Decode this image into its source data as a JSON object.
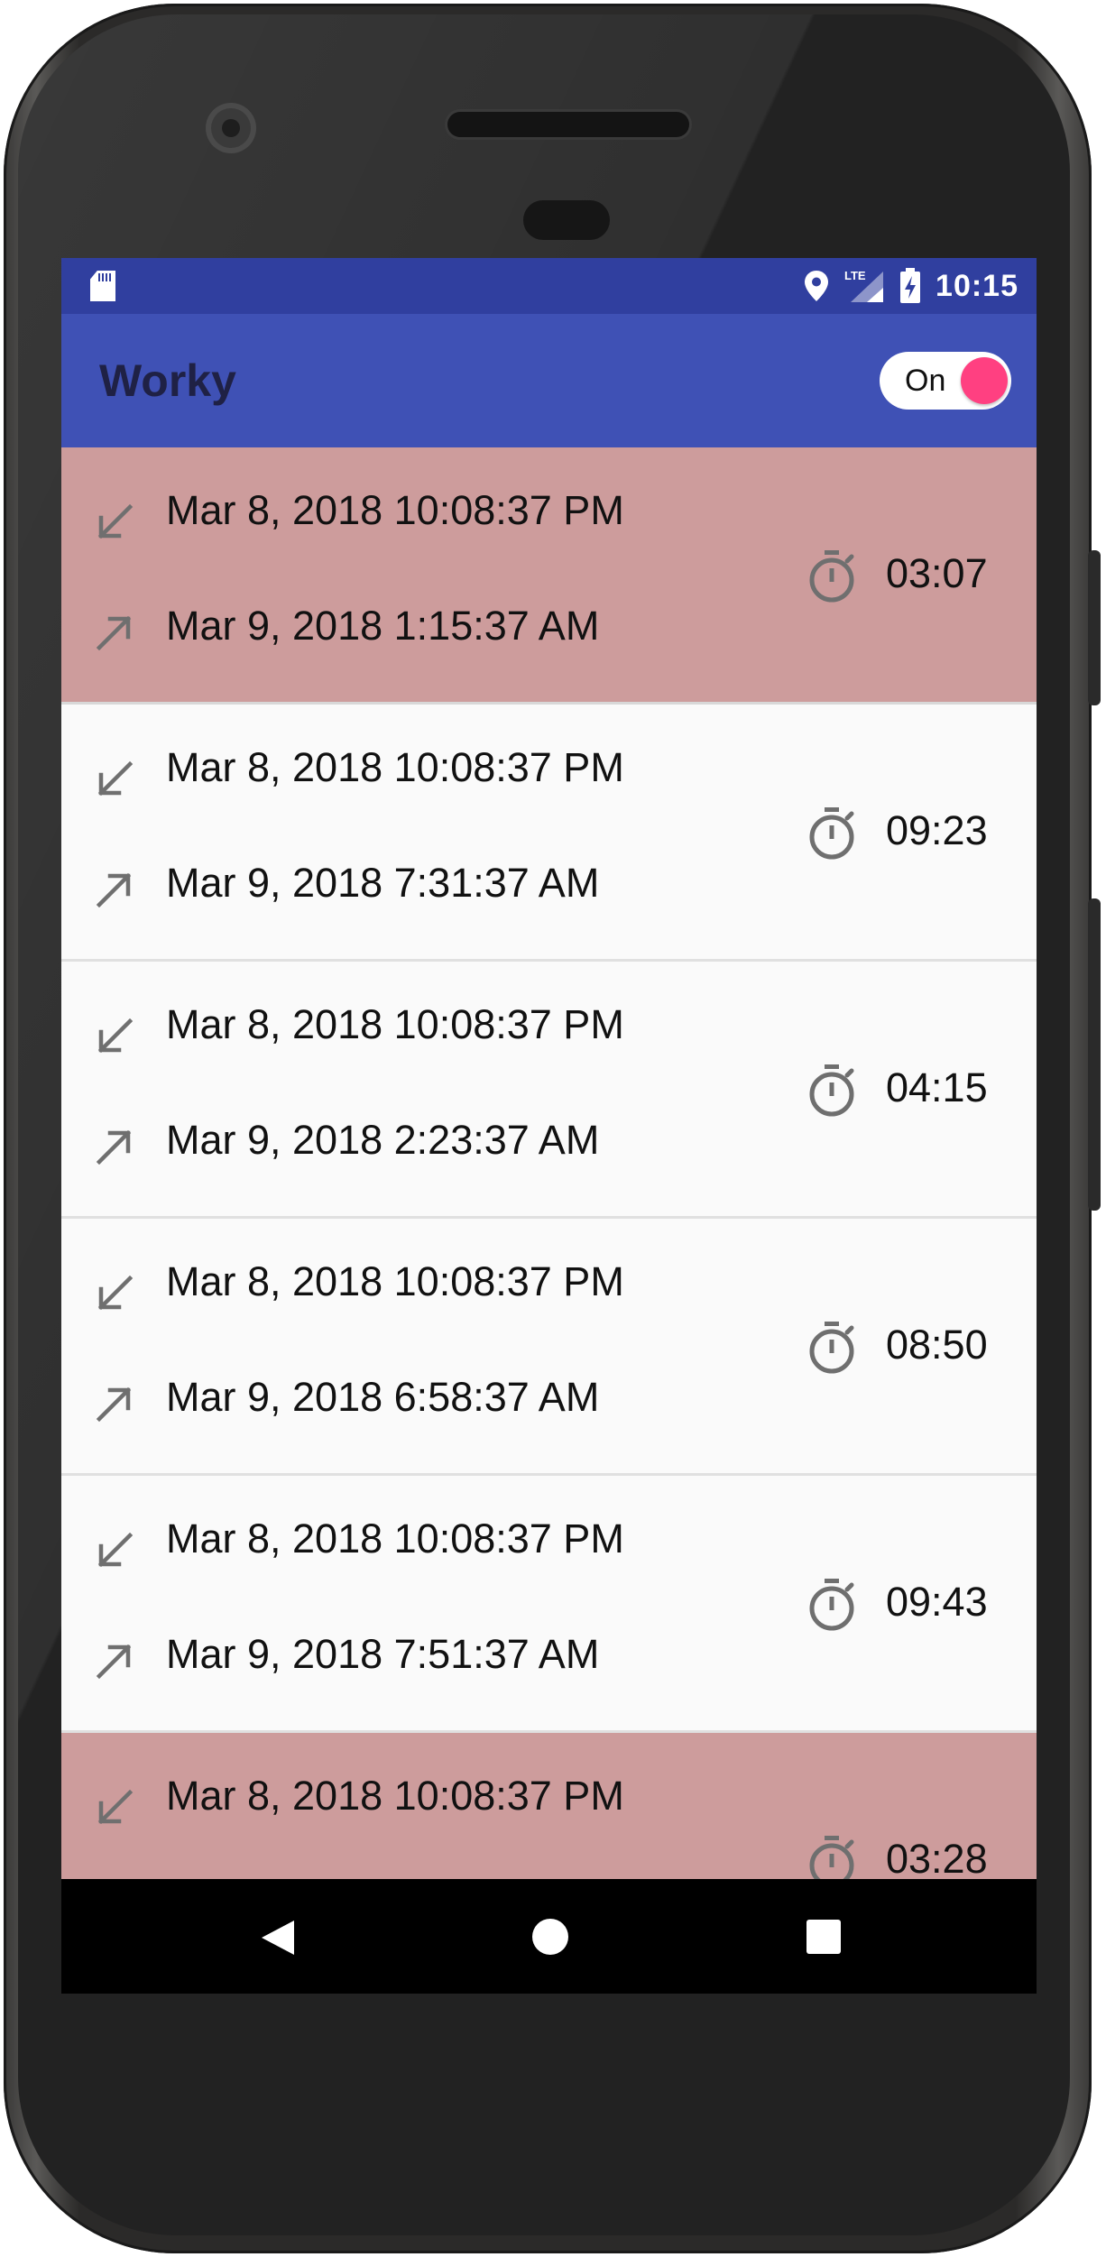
{
  "status_bar": {
    "time": "10:15",
    "network_label": "LTE",
    "left_icons": [
      "sd-card-icon"
    ],
    "right_icons": [
      "location-icon",
      "lte-signal-icon",
      "battery-charging-icon"
    ]
  },
  "app_bar": {
    "title": "Worky",
    "toggle": {
      "label": "On",
      "checked": true,
      "accent": "#ff4081"
    }
  },
  "colors": {
    "status_bar": "#303f9f",
    "app_bar": "#3f51b5",
    "row_short": "#cd9c9c",
    "row_normal": "#fafafa",
    "icon": "#6f6f6f"
  },
  "entries": [
    {
      "clock_in": "Mar 8, 2018 10:08:37 PM",
      "clock_out": "Mar 9, 2018 1:15:37 AM",
      "duration": "03:07",
      "highlight": true
    },
    {
      "clock_in": "Mar 8, 2018 10:08:37 PM",
      "clock_out": "Mar 9, 2018 7:31:37 AM",
      "duration": "09:23",
      "highlight": false
    },
    {
      "clock_in": "Mar 8, 2018 10:08:37 PM",
      "clock_out": "Mar 9, 2018 2:23:37 AM",
      "duration": "04:15",
      "highlight": false
    },
    {
      "clock_in": "Mar 8, 2018 10:08:37 PM",
      "clock_out": "Mar 9, 2018 6:58:37 AM",
      "duration": "08:50",
      "highlight": false
    },
    {
      "clock_in": "Mar 8, 2018 10:08:37 PM",
      "clock_out": "Mar 9, 2018 7:51:37 AM",
      "duration": "09:43",
      "highlight": false
    },
    {
      "clock_in": "Mar 8, 2018 10:08:37 PM",
      "clock_out": "",
      "duration": "03:28",
      "highlight": true
    }
  ],
  "icons": {
    "clock_in": "arrow-down-left-icon",
    "clock_out": "arrow-up-right-icon",
    "duration": "stopwatch-icon"
  },
  "nav_bar": {
    "buttons": [
      "back-icon",
      "home-icon",
      "recents-icon"
    ]
  }
}
